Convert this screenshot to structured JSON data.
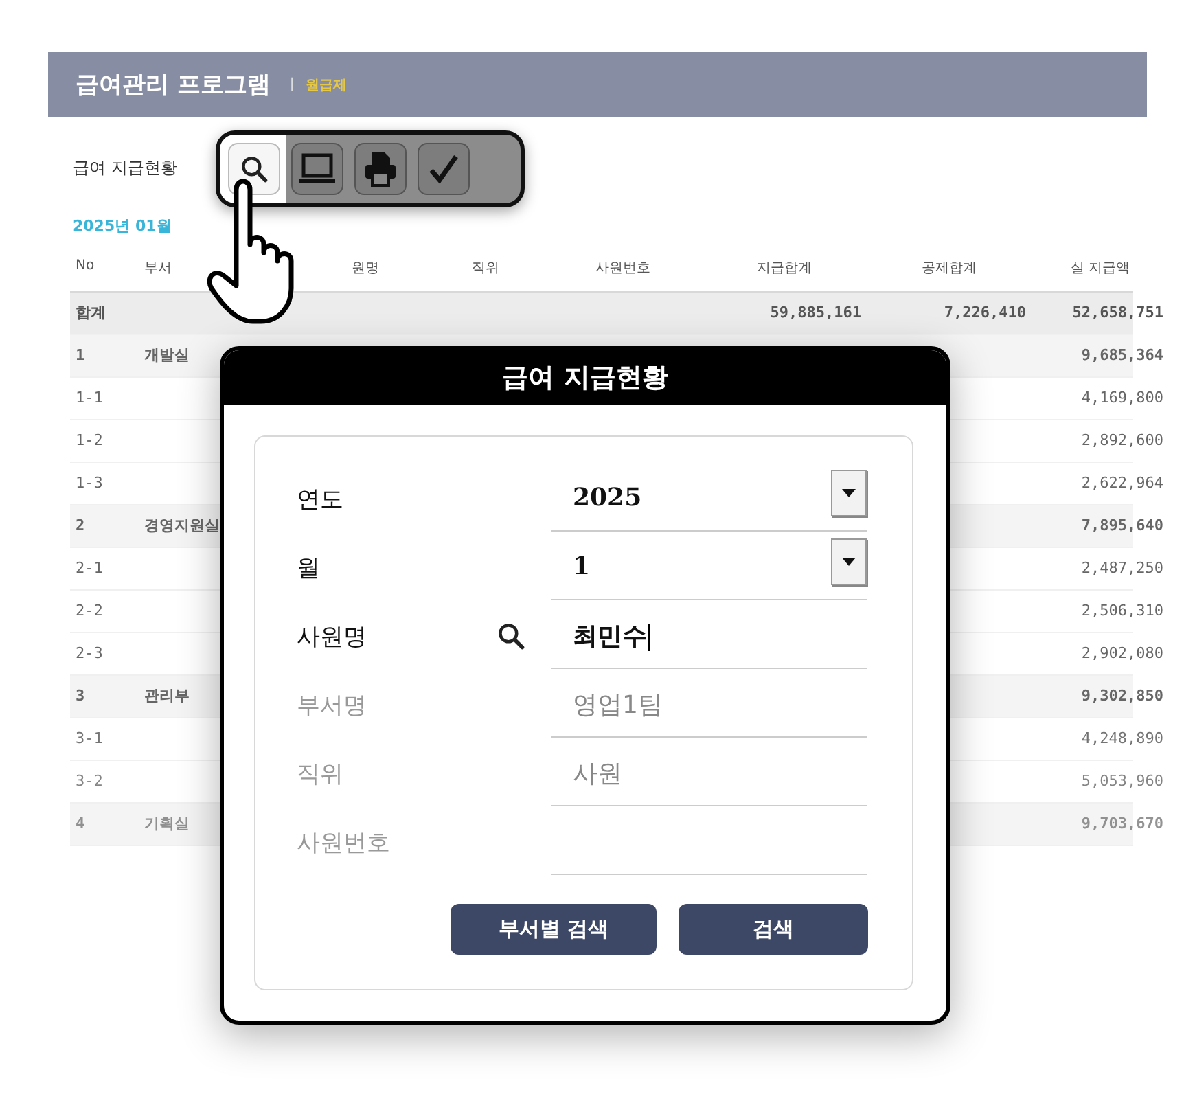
{
  "header": {
    "title": "급여관리 프로그램",
    "separator": "|",
    "mode": "월급제"
  },
  "section_title": "급여 지급현황",
  "toolbar": [
    {
      "selected": true
    },
    {
      "selected": false
    },
    {
      "selected": false
    },
    {
      "selected": false
    }
  ],
  "period": "2025년 01월",
  "table": {
    "columns": [
      "No",
      "부서",
      "원명",
      "직위",
      "사원번호",
      "지급합계",
      "공제합계",
      "실 지급액"
    ],
    "rows": [
      {
        "kind": "total",
        "cells": [
          "합계",
          "",
          "",
          "",
          "",
          "59,885,161",
          "7,226,410",
          "52,658,751"
        ]
      },
      {
        "kind": "group",
        "cells": [
          "1",
          "개발실",
          "",
          "",
          "",
          "",
          "",
          "9,685,364"
        ]
      },
      {
        "kind": "item",
        "cells": [
          "1-1",
          "",
          "",
          "",
          "",
          "",
          "",
          "4,169,800"
        ]
      },
      {
        "kind": "item",
        "cells": [
          "1-2",
          "",
          "",
          "",
          "",
          "",
          "",
          "2,892,600"
        ]
      },
      {
        "kind": "item",
        "cells": [
          "1-3",
          "",
          "",
          "",
          "",
          "",
          "",
          "2,622,964"
        ]
      },
      {
        "kind": "group",
        "cells": [
          "2",
          "경영지원실",
          "",
          "",
          "",
          "",
          "",
          "7,895,640"
        ]
      },
      {
        "kind": "item",
        "cells": [
          "2-1",
          "",
          "",
          "",
          "",
          "",
          "",
          "2,487,250"
        ]
      },
      {
        "kind": "item",
        "cells": [
          "2-2",
          "",
          "",
          "",
          "",
          "",
          "",
          "2,506,310"
        ]
      },
      {
        "kind": "item",
        "cells": [
          "2-3",
          "",
          "",
          "",
          "",
          "",
          "",
          "2,902,080"
        ]
      },
      {
        "kind": "group",
        "cells": [
          "3",
          "관리부",
          "",
          "",
          "",
          "",
          "",
          "9,302,850"
        ]
      },
      {
        "kind": "item",
        "cells": [
          "3-1",
          "",
          "",
          "",
          "",
          "",
          "",
          "4,248,890"
        ]
      },
      {
        "kind": "item",
        "cells": [
          "3-2",
          "",
          "",
          "",
          "",
          "",
          "",
          "5,053,960"
        ]
      },
      {
        "kind": "group",
        "cells": [
          "4",
          "기획실",
          "",
          "",
          "",
          "",
          "",
          "9,703,670"
        ]
      }
    ]
  },
  "dialog": {
    "title": "급여 지급현황",
    "fields": [
      {
        "label": "연도",
        "kind": "select",
        "value": "2025",
        "disabled": false,
        "focused": false,
        "search_icon": false
      },
      {
        "label": "월",
        "kind": "select",
        "value": "1",
        "disabled": false,
        "focused": false,
        "search_icon": false
      },
      {
        "label": "사원명",
        "kind": "text",
        "value": "최민수",
        "disabled": false,
        "focused": true,
        "search_icon": true
      },
      {
        "label": "부서명",
        "kind": "text",
        "value": "영업1팀",
        "disabled": true,
        "focused": false,
        "search_icon": false
      },
      {
        "label": "직위",
        "kind": "text",
        "value": "사원",
        "disabled": true,
        "focused": false,
        "search_icon": false
      },
      {
        "label": "사원번호",
        "kind": "text",
        "disabled": true,
        "focused": false,
        "search_icon": false
      }
    ],
    "buttons": [
      "부서별 검색",
      "검색"
    ]
  }
}
